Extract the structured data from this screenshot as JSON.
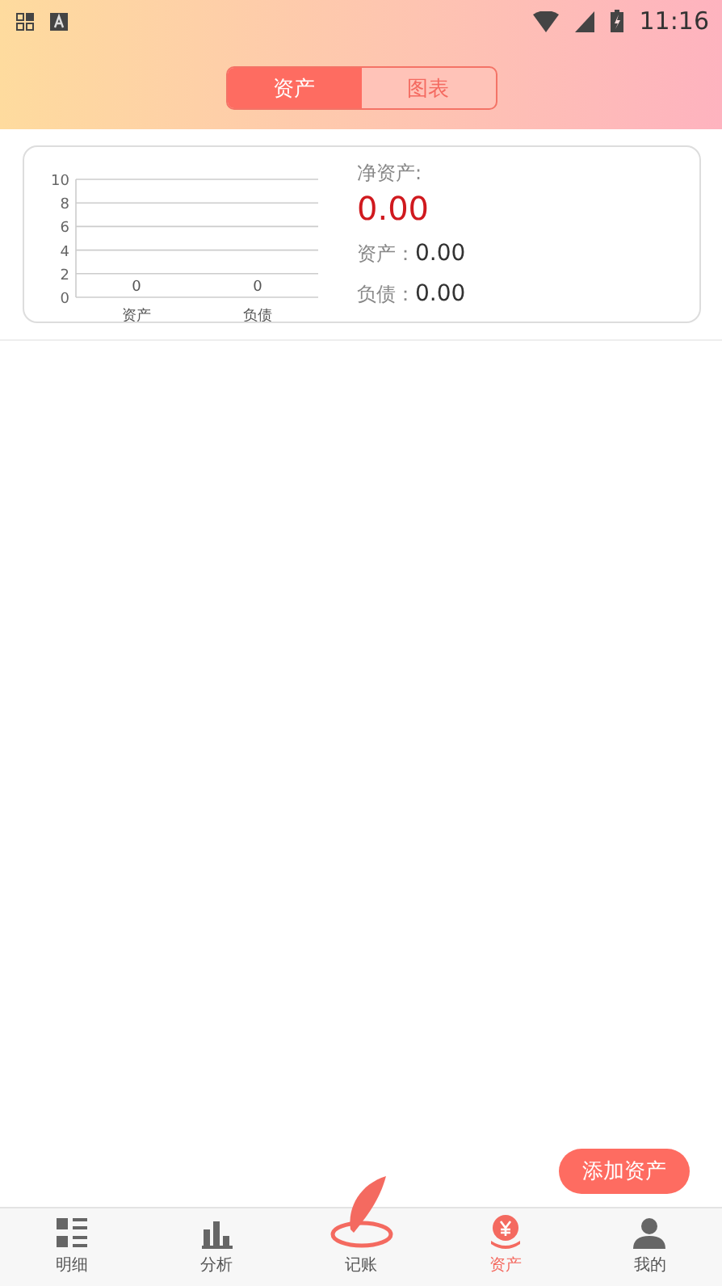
{
  "status_bar": {
    "time": "11:16"
  },
  "tabs": [
    {
      "label": "资产",
      "selected": true
    },
    {
      "label": "图表",
      "selected": false
    }
  ],
  "summary": {
    "chart_data": {
      "type": "bar",
      "categories": [
        "资产",
        "负债"
      ],
      "values": [
        0,
        0
      ],
      "ylim": [
        0,
        10
      ],
      "yticks": [
        0,
        2,
        4,
        6,
        8,
        10
      ],
      "data_labels": true,
      "grid": true
    },
    "net_label": "净资产:",
    "net_value": "0.00",
    "rows": [
      {
        "label": "资产：",
        "value": "0.00"
      },
      {
        "label": "负债：",
        "value": "0.00"
      }
    ]
  },
  "add_button": "添加资产",
  "nav": [
    {
      "label": "明细",
      "kind": "list",
      "selected": false
    },
    {
      "label": "分析",
      "kind": "bars",
      "selected": false
    },
    {
      "label": "记账",
      "kind": "feather",
      "selected": false
    },
    {
      "label": "资产",
      "kind": "money",
      "selected": true
    },
    {
      "label": "我的",
      "kind": "person",
      "selected": false
    }
  ]
}
